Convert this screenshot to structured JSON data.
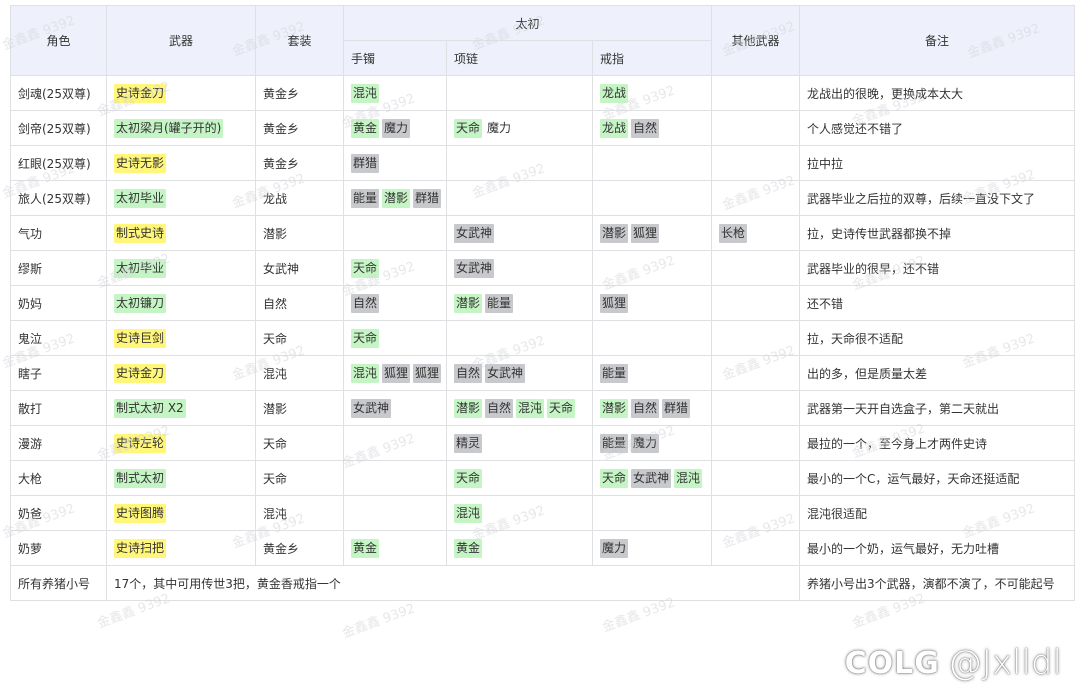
{
  "headers": {
    "role": "角色",
    "weapon": "武器",
    "set": "套装",
    "taichu": "太初",
    "bracelet": "手镯",
    "necklace": "项链",
    "ring": "戒指",
    "other_weapon": "其他武器",
    "note": "备注"
  },
  "tag_colors": {
    "yellow": "#fff67a",
    "green": "#c5f5c5",
    "gray": "#c8c9cc",
    "header_bg": "#eef1fb"
  },
  "rows": [
    {
      "role": "剑魂(25双尊)",
      "weapon": [
        {
          "t": "史诗金刀",
          "c": "yellow"
        }
      ],
      "set": "黄金乡",
      "bracelet": [
        {
          "t": "混沌",
          "c": "green"
        }
      ],
      "necklace": [],
      "ring": [
        {
          "t": "龙战",
          "c": "green"
        }
      ],
      "other": [],
      "note": "龙战出的很晚，更换成本太大"
    },
    {
      "role": "剑帝(25双尊)",
      "weapon": [
        {
          "t": "太初梁月(罐子开的)",
          "c": "green"
        }
      ],
      "set": "黄金乡",
      "bracelet": [
        {
          "t": "黄金",
          "c": "green"
        },
        {
          "t": "魔力",
          "c": "gray"
        }
      ],
      "necklace": [
        {
          "t": "天命",
          "c": "green"
        },
        {
          "t": "魔力",
          "c": "none"
        }
      ],
      "ring": [
        {
          "t": "龙战",
          "c": "green"
        },
        {
          "t": "自然",
          "c": "gray"
        }
      ],
      "other": [],
      "note": "个人感觉还不错了"
    },
    {
      "role": "红眼(25双尊)",
      "weapon": [
        {
          "t": "史诗无影",
          "c": "yellow"
        }
      ],
      "set": "黄金乡",
      "bracelet": [
        {
          "t": "群猎",
          "c": "gray"
        }
      ],
      "necklace": [],
      "ring": [],
      "other": [],
      "note": "拉中拉"
    },
    {
      "role": "旅人(25双尊)",
      "weapon": [
        {
          "t": "太初毕业",
          "c": "green"
        }
      ],
      "set": "龙战",
      "bracelet": [
        {
          "t": "能量",
          "c": "gray"
        },
        {
          "t": "潜影",
          "c": "green"
        },
        {
          "t": "群猎",
          "c": "gray"
        }
      ],
      "necklace": [],
      "ring": [],
      "other": [],
      "note": "武器毕业之后拉的双尊，后续一直没下文了"
    },
    {
      "role": "气功",
      "weapon": [
        {
          "t": "制式史诗",
          "c": "yellow"
        }
      ],
      "set": "潜影",
      "bracelet": [],
      "necklace": [
        {
          "t": "女武神",
          "c": "gray"
        }
      ],
      "ring": [
        {
          "t": "潜影",
          "c": "gray"
        },
        {
          "t": "狐狸",
          "c": "gray"
        }
      ],
      "other": [
        {
          "t": "长枪",
          "c": "gray"
        }
      ],
      "note": "拉，史诗传世武器都换不掉"
    },
    {
      "role": "缪斯",
      "weapon": [
        {
          "t": "太初毕业",
          "c": "green"
        }
      ],
      "set": "女武神",
      "bracelet": [
        {
          "t": "天命",
          "c": "green"
        }
      ],
      "necklace": [
        {
          "t": "女武神",
          "c": "gray"
        }
      ],
      "ring": [],
      "other": [],
      "note": "武器毕业的很早，还不错"
    },
    {
      "role": "奶妈",
      "weapon": [
        {
          "t": "太初镰刀",
          "c": "green"
        }
      ],
      "set": "自然",
      "bracelet": [
        {
          "t": "自然",
          "c": "gray"
        }
      ],
      "necklace": [
        {
          "t": "潜影",
          "c": "green"
        },
        {
          "t": "能量",
          "c": "gray"
        }
      ],
      "ring": [
        {
          "t": "狐狸",
          "c": "gray"
        }
      ],
      "other": [],
      "note": "还不错"
    },
    {
      "role": "鬼泣",
      "weapon": [
        {
          "t": "史诗巨剑",
          "c": "yellow"
        }
      ],
      "set": "天命",
      "bracelet": [
        {
          "t": "天命",
          "c": "green"
        }
      ],
      "necklace": [],
      "ring": [],
      "other": [],
      "note": "拉，天命很不适配"
    },
    {
      "role": "瞎子",
      "weapon": [
        {
          "t": "史诗金刀",
          "c": "yellow"
        }
      ],
      "set": "混沌",
      "bracelet": [
        {
          "t": "混沌",
          "c": "green"
        },
        {
          "t": "狐狸",
          "c": "gray"
        },
        {
          "t": "狐狸",
          "c": "gray"
        }
      ],
      "necklace": [
        {
          "t": "自然",
          "c": "gray"
        },
        {
          "t": "女武神",
          "c": "gray"
        }
      ],
      "ring": [
        {
          "t": "能量",
          "c": "gray"
        }
      ],
      "other": [],
      "note": "出的多，但是质量太差"
    },
    {
      "role": "散打",
      "weapon": [
        {
          "t": "制式太初 X2",
          "c": "green"
        }
      ],
      "set": "潜影",
      "bracelet": [
        {
          "t": "女武神",
          "c": "gray"
        }
      ],
      "necklace": [
        {
          "t": "潜影",
          "c": "green"
        },
        {
          "t": "自然",
          "c": "gray"
        },
        {
          "t": "混沌",
          "c": "green"
        },
        {
          "t": "天命",
          "c": "green"
        }
      ],
      "ring": [
        {
          "t": "潜影",
          "c": "green"
        },
        {
          "t": "自然",
          "c": "gray"
        },
        {
          "t": "群猎",
          "c": "gray"
        }
      ],
      "other": [],
      "note": "武器第一天开自选盒子，第二天就出"
    },
    {
      "role": "漫游",
      "weapon": [
        {
          "t": "史诗左轮",
          "c": "yellow"
        }
      ],
      "set": "天命",
      "bracelet": [],
      "necklace": [
        {
          "t": "精灵",
          "c": "gray"
        }
      ],
      "ring": [
        {
          "t": "能量",
          "c": "gray"
        },
        {
          "t": "魔力",
          "c": "gray"
        }
      ],
      "other": [],
      "note": "最拉的一个，至今身上才两件史诗"
    },
    {
      "role": "大枪",
      "weapon": [
        {
          "t": "制式太初",
          "c": "green"
        }
      ],
      "set": "天命",
      "bracelet": [],
      "necklace": [
        {
          "t": "天命",
          "c": "green"
        }
      ],
      "ring": [
        {
          "t": "天命",
          "c": "green"
        },
        {
          "t": "女武神",
          "c": "gray"
        },
        {
          "t": "混沌",
          "c": "green"
        }
      ],
      "other": [],
      "note": "最小的一个C，运气最好，天命还挺适配"
    },
    {
      "role": "奶爸",
      "weapon": [
        {
          "t": "史诗图腾",
          "c": "yellow"
        }
      ],
      "set": "混沌",
      "bracelet": [],
      "necklace": [
        {
          "t": "混沌",
          "c": "green"
        }
      ],
      "ring": [],
      "other": [],
      "note": "混沌很适配"
    },
    {
      "role": "奶萝",
      "weapon": [
        {
          "t": "史诗扫把",
          "c": "yellow"
        }
      ],
      "set": "黄金乡",
      "bracelet": [
        {
          "t": "黄金",
          "c": "green"
        }
      ],
      "necklace": [
        {
          "t": "黄金",
          "c": "green"
        }
      ],
      "ring": [
        {
          "t": "魔力",
          "c": "gray"
        }
      ],
      "other": [],
      "note": "最小的一个奶，运气最好，无力吐槽"
    }
  ],
  "summary": {
    "role": "所有养猪小号",
    "text": "17个，其中可用传世3把，黄金香戒指一个",
    "note": "养猪小号出3个武器，演都不演了，不可能起号"
  },
  "watermark": "金鑫鑫 9392",
  "brand": {
    "logo": "COLG",
    "handle": "@Jxlldl"
  }
}
